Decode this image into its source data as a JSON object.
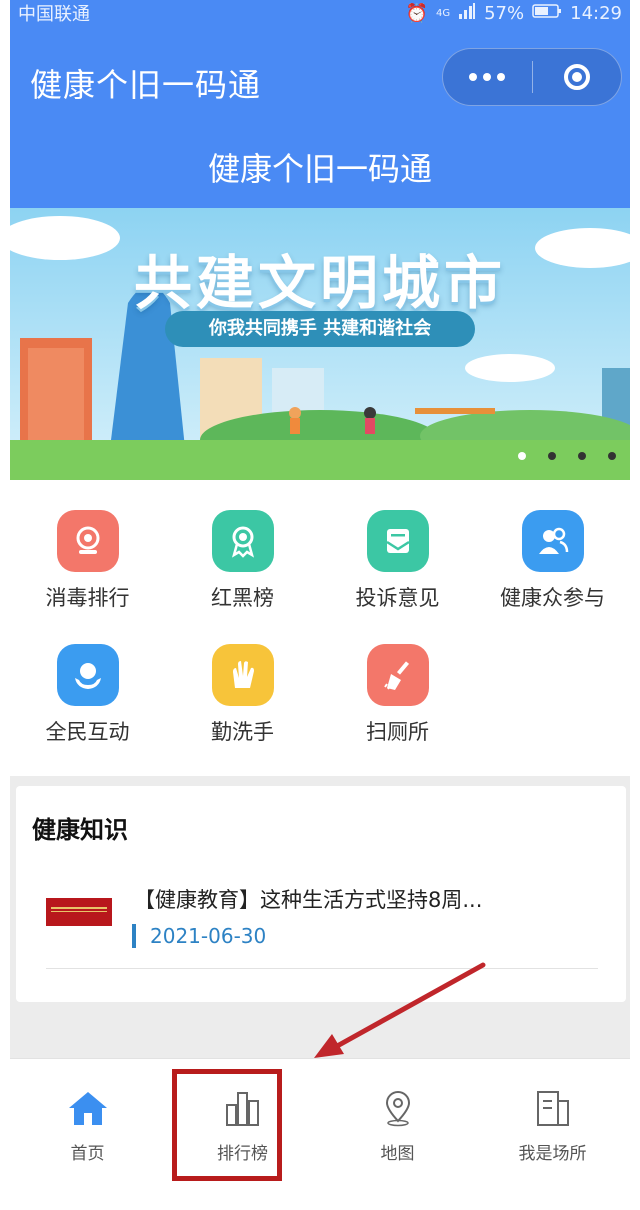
{
  "status_bar": {
    "carrier": "中国联通",
    "network": "4G",
    "battery": "57%",
    "time": "14:29",
    "icons": [
      "alarm-icon",
      "signal-icon",
      "battery-icon"
    ]
  },
  "header": {
    "app_title": "健康个旧一码通",
    "page_title": "健康个旧一码通",
    "capsule_icons": [
      "more-icon",
      "close-target-icon"
    ]
  },
  "banner": {
    "title": "共建文明城市",
    "subtitle": "你我共同携手 共建和谐社会",
    "slide_count": 4,
    "active_slide": 1
  },
  "grid": [
    {
      "label": "消毒排行",
      "icon": "disinfect-icon",
      "color": "#f3776a"
    },
    {
      "label": "红黑榜",
      "icon": "award-icon",
      "color": "#3cc7a4"
    },
    {
      "label": "投诉意见",
      "icon": "mail-icon",
      "color": "#3cc7a4"
    },
    {
      "label": "健康众参与",
      "icon": "people-icon",
      "color": "#3b9cf0"
    },
    {
      "label": "全民互动",
      "icon": "hands-icon",
      "color": "#3b9cf0"
    },
    {
      "label": "勤洗手",
      "icon": "clap-icon",
      "color": "#f7c43a"
    },
    {
      "label": "扫厕所",
      "icon": "broom-icon",
      "color": "#f3776a"
    }
  ],
  "health_knowledge": {
    "title": "健康知识",
    "items": [
      {
        "title": "【健康教育】这种生活方式坚持8周...",
        "date": "2021-06-30"
      }
    ]
  },
  "tabbar": [
    {
      "label": "首页",
      "icon": "home-icon",
      "active": true
    },
    {
      "label": "排行榜",
      "icon": "bar-chart-icon",
      "active": false
    },
    {
      "label": "地图",
      "icon": "map-pin-icon",
      "active": false
    },
    {
      "label": "我是场所",
      "icon": "building-icon",
      "active": false
    }
  ],
  "colors": {
    "primary": "#4a8af4",
    "highlight_box": "#b81c1c",
    "date_accent": "#2d82c4"
  }
}
